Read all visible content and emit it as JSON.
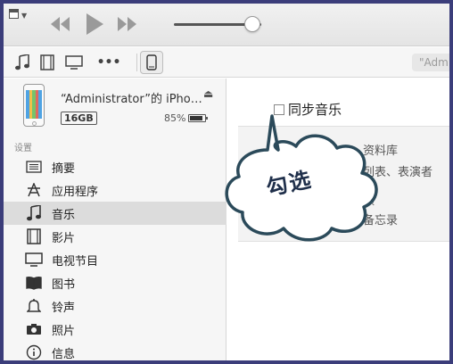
{
  "toolbar": {
    "icons": [
      "window-menu-icon",
      "rewind-icon",
      "play-icon",
      "fast-forward-icon"
    ],
    "volume_level": 0.9
  },
  "library_bar": {
    "icons": [
      "music-note-icon",
      "film-icon",
      "tv-icon",
      "more-icon",
      "iphone-icon"
    ],
    "more_label": "•••",
    "account_text": "\"Adm"
  },
  "device": {
    "name": "“Administrator”的 iPho…",
    "capacity": "16GB",
    "battery": "85%"
  },
  "sidebar": {
    "section_label": "设置",
    "items": [
      {
        "label": "摘要",
        "icon": "summary-list-icon"
      },
      {
        "label": "应用程序",
        "icon": "apps-icon"
      },
      {
        "label": "音乐",
        "icon": "music-note-icon"
      },
      {
        "label": "影片",
        "icon": "film-icon"
      },
      {
        "label": "电视节目",
        "icon": "tv-icon"
      },
      {
        "label": "图书",
        "icon": "book-icon"
      },
      {
        "label": "铃声",
        "icon": "bell-icon"
      },
      {
        "label": "照片",
        "icon": "camera-icon"
      },
      {
        "label": "信息",
        "icon": "info-icon"
      }
    ],
    "active_index": 2
  },
  "main": {
    "sync_label": "同步音乐",
    "sync_checked": false,
    "options": [
      "资料库",
      "列表、表演者",
      "频",
      "备忘录"
    ]
  },
  "callout": {
    "text": "勾选"
  },
  "colors": {
    "frame": "#3b3d7a",
    "callout_fill": "#ffffff",
    "callout_stroke": "#2b4a5a",
    "active_row": "#dcdcdc"
  }
}
